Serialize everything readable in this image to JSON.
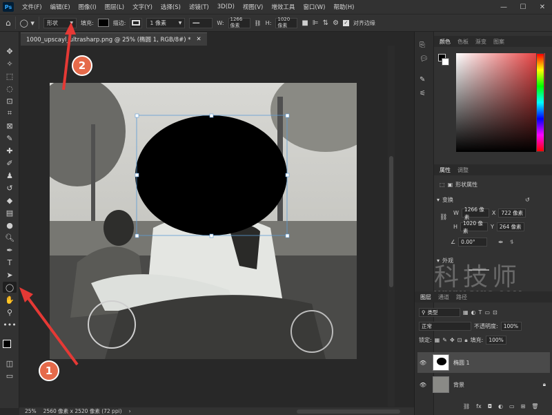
{
  "menubar": {
    "logo": "Ps",
    "items": [
      "文件(F)",
      "编辑(E)",
      "图像(I)",
      "图层(L)",
      "文字(Y)",
      "选择(S)",
      "滤镜(T)",
      "3D(D)",
      "视图(V)",
      "增效工具",
      "窗口(W)",
      "帮助(H)"
    ]
  },
  "options": {
    "mode": "形状",
    "fill_label": "填充:",
    "stroke_label": "描边:",
    "stroke_width": "1 像素",
    "w_label": "W:",
    "w_value": "1266 像素",
    "h_label": "H:",
    "h_value": "1020 像素",
    "align_edges": "对齐边缘"
  },
  "document": {
    "tab_title": "1000_upscayl_ultrasharp.png @ 25% (椭圆 1, RGB/8#) *",
    "zoom": "25%",
    "doc_info": "2560 像素 x 2520 像素 (72 ppi)"
  },
  "color_panel": {
    "tabs": [
      "颜色",
      "色板",
      "渐变",
      "图案"
    ],
    "hue_color": "#e53030"
  },
  "properties": {
    "tabs": [
      "属性",
      "调整"
    ],
    "shape_props": "形状属性",
    "transform_title": "变换",
    "w_label": "W",
    "w_value": "1266 像素",
    "x_label": "X",
    "x_value": "722 像素",
    "h_label": "H",
    "h_value": "1020 像素",
    "y_label": "Y",
    "y_value": "264 像素",
    "angle": "0.00°",
    "appearance_title": "外观"
  },
  "layers_panel": {
    "tabs": [
      "图层",
      "通道",
      "路径"
    ],
    "filter_kind": "类型",
    "blend_mode": "正常",
    "opacity_label": "不透明度:",
    "opacity_value": "100%",
    "lock_label": "锁定:",
    "fill_label": "填充:",
    "fill_value": "100%",
    "layers": [
      {
        "name": "椭圆 1",
        "selected": true
      },
      {
        "name": "背景",
        "selected": false
      }
    ]
  },
  "annotations": {
    "badge1": "1",
    "badge2": "2",
    "watermark_cn": "科技师",
    "watermark_url": "WWW.3KJS.COM"
  }
}
